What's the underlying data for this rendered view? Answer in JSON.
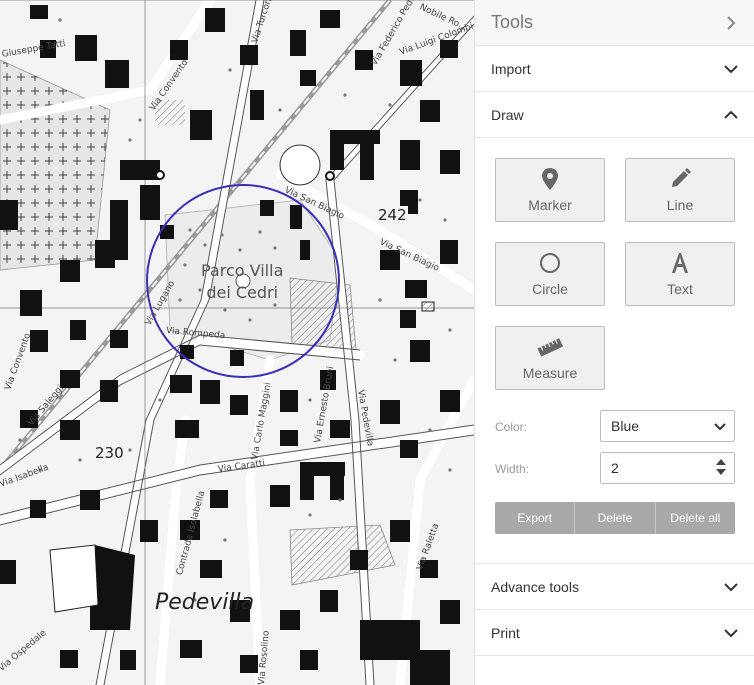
{
  "map": {
    "park_label_line1": "Parco Villa",
    "park_label_line2": "dei Cedri",
    "place_label": "Pedevilla",
    "elevations": [
      "242",
      "230"
    ],
    "streets": {
      "turconi": "Via Turconi",
      "convento": "Via Convento",
      "tatti": "Giuseppe Tatti",
      "federico": "Via Federico Pedotti",
      "nobile": "Nobile Ro...",
      "colombi": "Via Luigi Colombi",
      "san_biagio": "Via San Biagio",
      "san_biagio2": "Via San Biagio",
      "lugano": "Via Lugano",
      "rompeda": "Via Rompeda",
      "convento2": "Via Convento",
      "saleggi": "Via Saleggi",
      "pedevilla": "Via Pedevilla",
      "ernesto": "Via Ernesto Bruni",
      "carlo": "Via Carlo Maggini",
      "caratti": "Via Caratti",
      "isabella": "Via Isabella",
      "contrada": "Contrada Isolabella",
      "raletta": "Via Raletta",
      "ospedale": "Via Ospedale",
      "rosolino": "Via Rosolino"
    }
  },
  "panel": {
    "title": "Tools",
    "sections": {
      "import": "Import",
      "draw": "Draw",
      "advance": "Advance tools",
      "print": "Print"
    },
    "tools": {
      "marker": "Marker",
      "line": "Line",
      "circle": "Circle",
      "text": "Text",
      "measure": "Measure"
    },
    "form": {
      "color_label": "Color:",
      "color_value": "Blue",
      "width_label": "Width:",
      "width_value": "2"
    },
    "actions": {
      "export": "Export",
      "delete": "Delete",
      "delete_all": "Delete all"
    },
    "colors": {
      "circle": "#3a2fb8",
      "button_bar": "#a9a9a9"
    }
  }
}
